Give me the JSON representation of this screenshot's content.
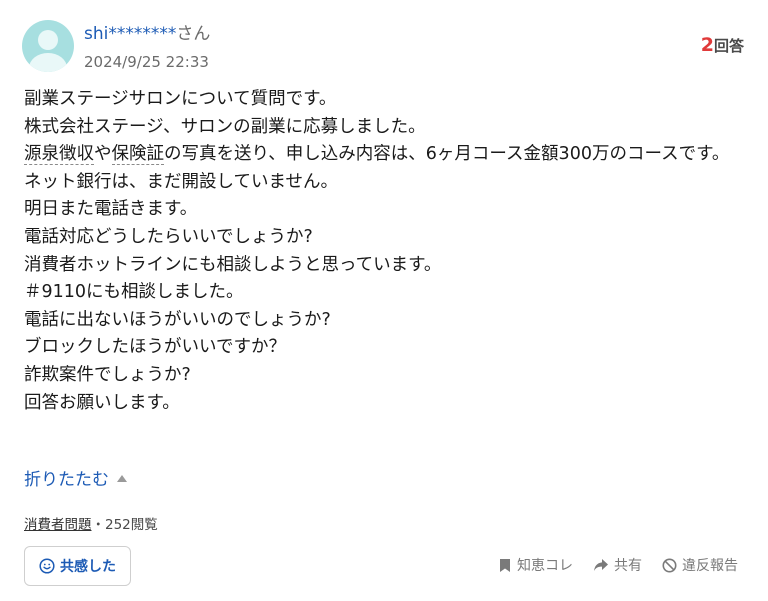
{
  "user": {
    "name": "shi********",
    "suffix": "さん",
    "date": "2024/9/25 22:33"
  },
  "answers": {
    "count": "2",
    "label": "回答"
  },
  "question": {
    "line1": "副業ステージサロンについて質問です。",
    "line2": "株式会社ステージ、サロンの副業に応募しました。",
    "line3_kw1": "源泉徴収",
    "line3_mid": "や",
    "line3_kw2": "保険証",
    "line3_rest": "の写真を送り、申し込み内容は、6ヶ月コース金額300万のコースです。",
    "line4": "ネット銀行は、まだ開設していません。",
    "line5": "明日また電話きます。",
    "line6": "電話対応どうしたらいいでしょうか?",
    "line7": "消費者ホットラインにも相談しようと思っています。",
    "line8": "＃9110にも相談しました。",
    "line9": "電話に出ないほうがいいのでしょうか?",
    "line10": "ブロックしたほうがいいですか？",
    "line11": "詐欺案件でしょうか?",
    "line12": "回答お願いします。"
  },
  "collapse_label": "折りたたむ",
  "meta": {
    "category": "消費者問題",
    "separator": "・",
    "views": "252閲覧"
  },
  "buttons": {
    "sympathy": "共感した",
    "chiebukuro": "知恵コレ",
    "share": "共有",
    "report": "違反報告"
  },
  "colors": {
    "link": "#1d5bb5",
    "answer_count": "#e03a3a",
    "avatar": "#a7dfe0"
  }
}
